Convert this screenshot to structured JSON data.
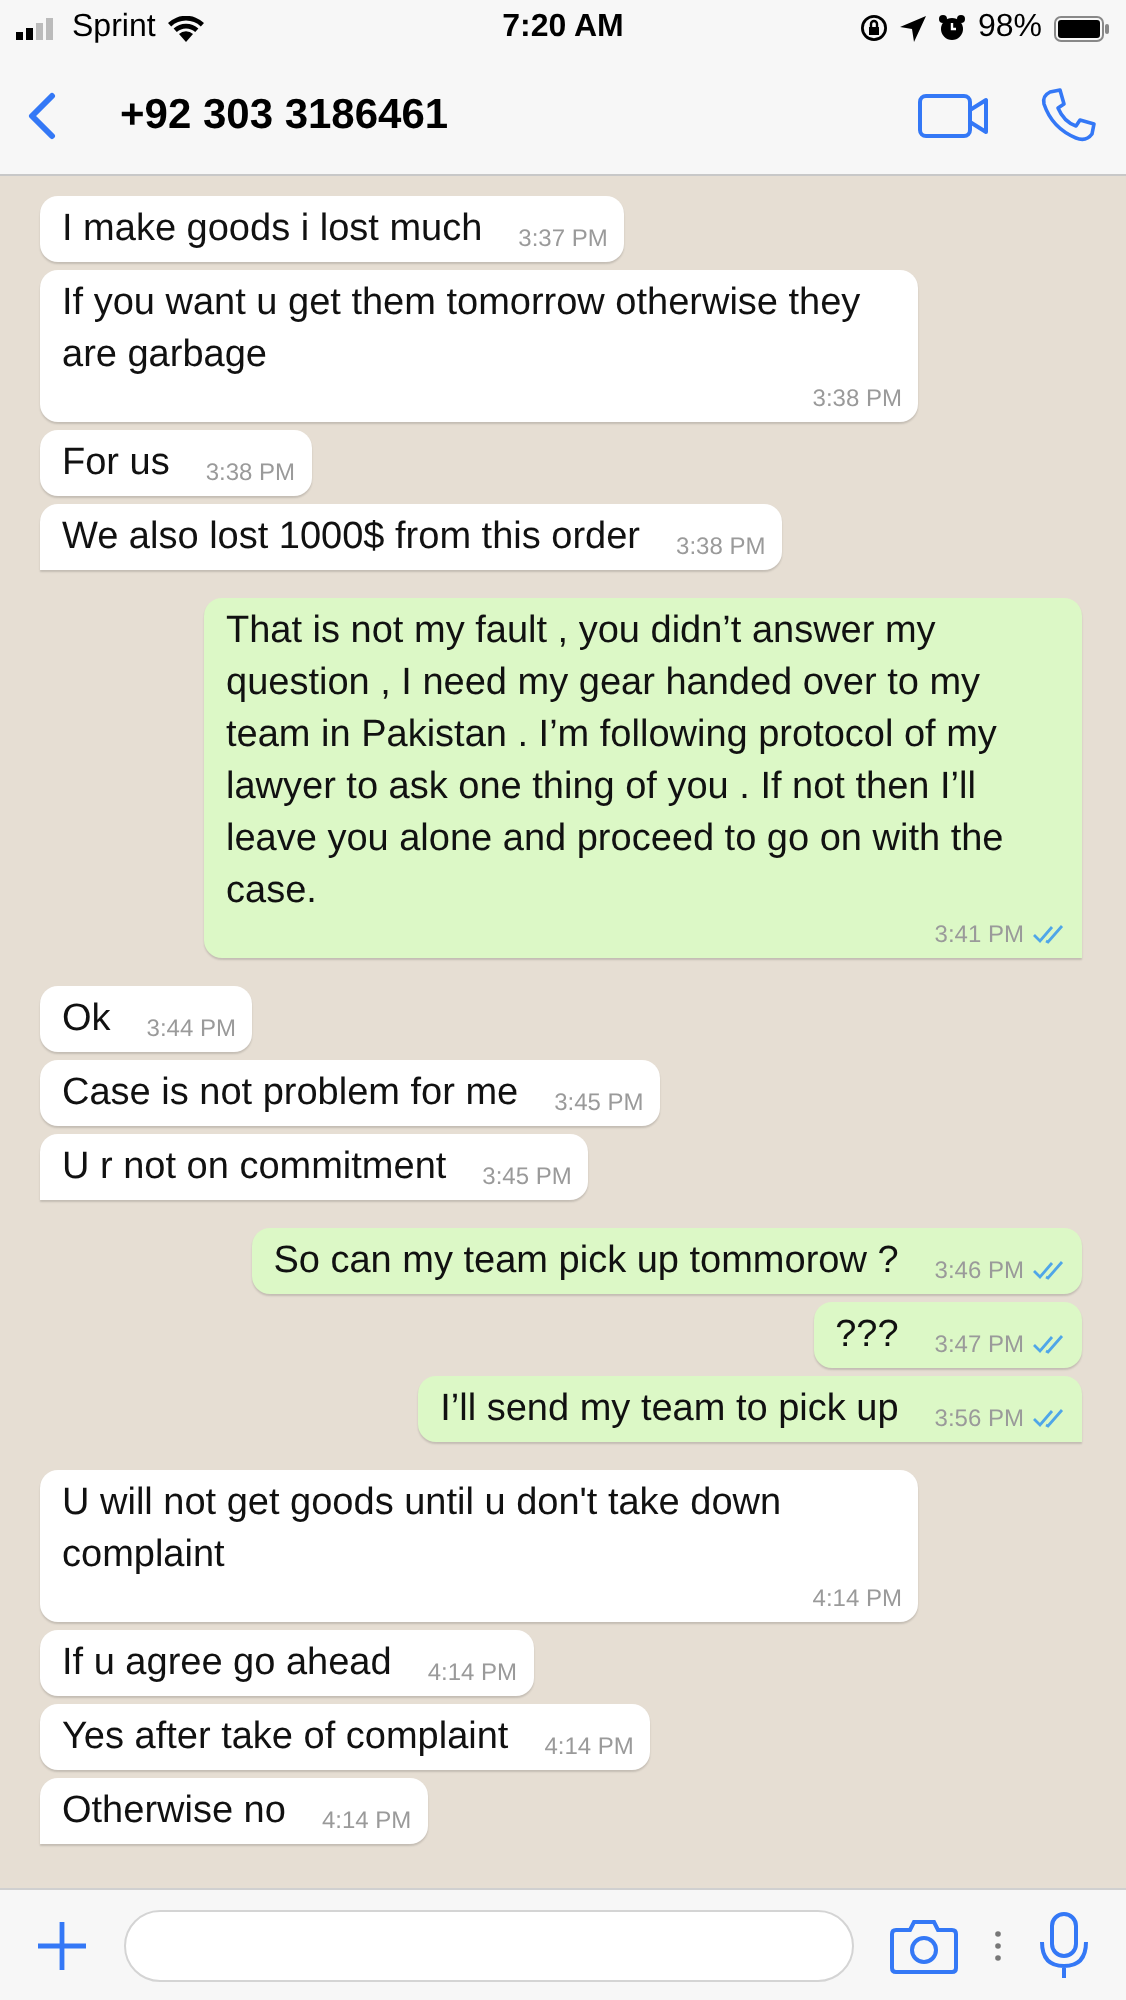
{
  "status_bar": {
    "carrier": "Sprint",
    "time": "7:20 AM",
    "battery": "98%"
  },
  "chat_header": {
    "title": "+92 303 3186461"
  },
  "messages": [
    {
      "outgoing": false,
      "text": "I make goods i lost much",
      "time": "3:37 PM",
      "tail": false
    },
    {
      "outgoing": false,
      "text": "If you want u get them tomorrow otherwise they are garbage",
      "time": "3:38 PM",
      "tail": false
    },
    {
      "outgoing": false,
      "text": "For us",
      "time": "3:38 PM",
      "tail": false
    },
    {
      "outgoing": false,
      "text": "We also lost 1000$ from this order",
      "time": "3:38 PM",
      "tail": true
    },
    {
      "outgoing": true,
      "text": "That is not my fault , you didn’t answer my question , I need my gear handed over to my team in Pakistan  . I’m following protocol of my lawyer to ask one thing of you . If not then I’ll leave you alone and proceed to go on with the case.",
      "time": "3:41 PM",
      "tail": true,
      "read": true
    },
    {
      "outgoing": false,
      "text": "Ok",
      "time": "3:44 PM",
      "tail": false
    },
    {
      "outgoing": false,
      "text": "Case is not problem for me",
      "time": "3:45 PM",
      "tail": false
    },
    {
      "outgoing": false,
      "text": "U r not on commitment",
      "time": "3:45 PM",
      "tail": true
    },
    {
      "outgoing": true,
      "text": "So can my team pick up tommorow ?",
      "time": "3:46 PM",
      "tail": false,
      "read": true
    },
    {
      "outgoing": true,
      "text": "???",
      "time": "3:47 PM",
      "tail": false,
      "read": true
    },
    {
      "outgoing": true,
      "text": "I’ll send my team to pick up",
      "time": "3:56 PM",
      "tail": true,
      "read": true
    },
    {
      "outgoing": false,
      "text": "U will not get goods until u don't take down complaint",
      "time": "4:14 PM",
      "tail": false
    },
    {
      "outgoing": false,
      "text": "If u agree go ahead",
      "time": "4:14 PM",
      "tail": false
    },
    {
      "outgoing": false,
      "text": "Yes after take of complaint",
      "time": "4:14 PM",
      "tail": false
    },
    {
      "outgoing": false,
      "text": "Otherwise no",
      "time": "4:14 PM",
      "tail": true
    }
  ]
}
